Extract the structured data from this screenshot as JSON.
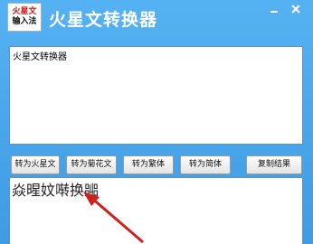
{
  "window": {
    "logo_line1": "火星文",
    "logo_line2": "输入法",
    "title": "火星文转换器",
    "minimize_icon": "minimize-icon",
    "close_icon": "close-icon",
    "titlebar_color": "#4aa3e8"
  },
  "input": {
    "text": "火星文转换器"
  },
  "buttons": {
    "to_martian": "转为火星文",
    "to_chrysanthemum": "转为菊花文",
    "to_traditional": "转为繁体",
    "to_simplified": "转为简体",
    "copy_result": "复制结果"
  },
  "output": {
    "text": "焱暒妏啭换嘂"
  },
  "annotation": {
    "arrow_color": "#d02020"
  }
}
